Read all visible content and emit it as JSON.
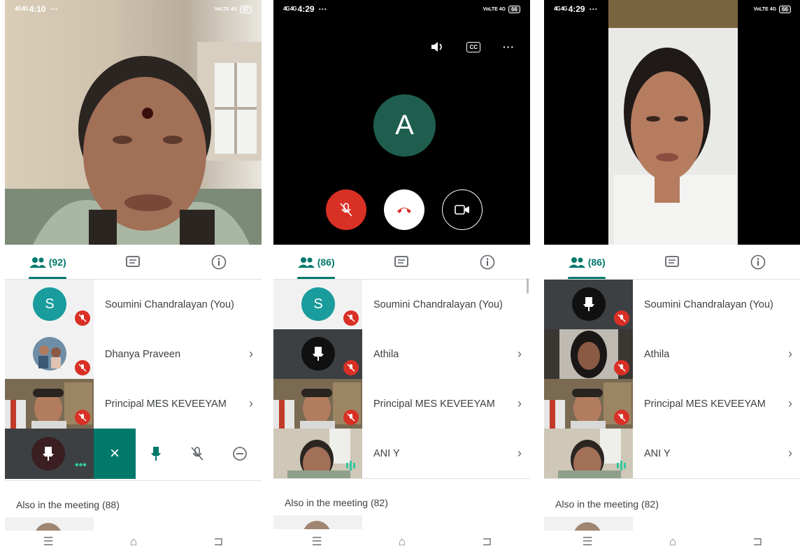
{
  "phones": [
    {
      "status": {
        "signal": "4G 4G",
        "time": "4:10",
        "extra": "···",
        "right": "VoLTE 4G",
        "battery": "67"
      },
      "tabs": {
        "people_count": "(92)"
      },
      "participants": [
        {
          "name": "Soumini Chandralayan (You)",
          "initial": "S"
        },
        {
          "name": "Dhanya Praveen"
        },
        {
          "name": "Principal MES KEVEEYAM"
        }
      ],
      "actions": {
        "close": "×"
      },
      "also": "Also in the meeting (88)"
    },
    {
      "status": {
        "signal": "4G 4G",
        "time": "4:29",
        "extra": "···",
        "right": "VoLTE 4G",
        "battery": "66"
      },
      "top_controls": {
        "more": "···",
        "cc": "CC"
      },
      "caller_initial": "A",
      "tabs": {
        "people_count": "(86)"
      },
      "participants": [
        {
          "name": "Soumini Chandralayan (You)",
          "initial": "S"
        },
        {
          "name": "Athila"
        },
        {
          "name": "Principal MES KEVEEYAM"
        },
        {
          "name": "ANI Y"
        }
      ],
      "also": "Also in the meeting (82)"
    },
    {
      "status": {
        "signal": "4G 4G",
        "time": "4:29",
        "extra": "···",
        "right": "VoLTE 4G",
        "battery": "66"
      },
      "tabs": {
        "people_count": "(86)"
      },
      "participants": [
        {
          "name": "Soumini Chandralayan (You)"
        },
        {
          "name": "Athila"
        },
        {
          "name": "Principal MES KEVEEYAM"
        },
        {
          "name": "ANI Y"
        }
      ],
      "also": "Also in the meeting (82)"
    }
  ],
  "navbar": {
    "menu": "☰",
    "home": "⌂",
    "back": "⊐"
  },
  "colors": {
    "accent": "#00796b",
    "mute_red": "#d93025",
    "avatar_teal": "#1a9c9c",
    "dark_avatar": "#1f5e4e"
  }
}
